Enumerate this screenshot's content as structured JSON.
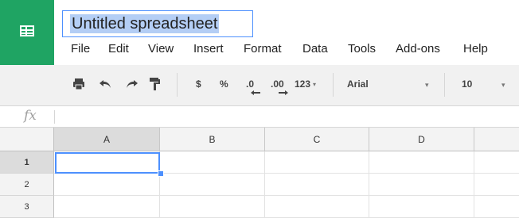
{
  "app": {
    "title": "Untitled spreadsheet",
    "logo_icon": "sheets-logo-icon",
    "brand_color": "#1fa463",
    "accent_color": "#4d90fe"
  },
  "menu": [
    "File",
    "Edit",
    "View",
    "Insert",
    "Format",
    "Data",
    "Tools",
    "Add-ons",
    "Help"
  ],
  "toolbar": {
    "print_icon": "print-icon",
    "undo_icon": "undo-icon",
    "redo_icon": "redo-icon",
    "paint_format_icon": "paint-format-icon",
    "currency_label": "$",
    "percent_label": "%",
    "decrease_decimal_label": ".0",
    "increase_decimal_label": ".00",
    "more_formats_label": "123",
    "font_family": "Arial",
    "font_size": "10"
  },
  "formula_bar": {
    "fx_label": "fx",
    "value": ""
  },
  "grid": {
    "columns": [
      "A",
      "B",
      "C",
      "D",
      ""
    ],
    "rows": [
      "1",
      "2",
      "3"
    ],
    "selected_cell": "A1"
  }
}
